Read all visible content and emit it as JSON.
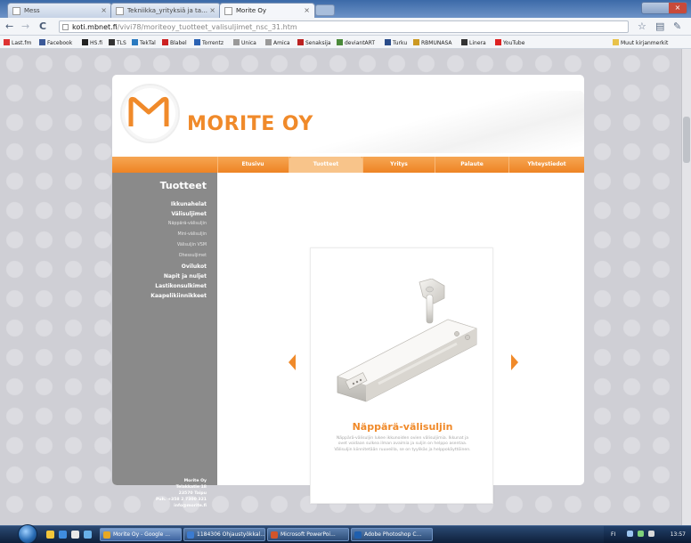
{
  "browser": {
    "tabs": [
      {
        "label": "Mess"
      },
      {
        "label": "Tekniikka_yrityksiä ja ta…"
      },
      {
        "label": "Morite Oy"
      }
    ],
    "address": {
      "host": "koti.mbnet.fi",
      "path": "/vivi78/moriteoy_tuotteet_valisuljimet_nsc_31.htm"
    },
    "nav_glyphs": {
      "back": "←",
      "forward": "→",
      "reload": "C"
    },
    "bookmarks": [
      {
        "label": "Last.fm",
        "color": "#d33"
      },
      {
        "label": "Facebook",
        "color": "#3b5998"
      },
      {
        "label": "HS.fi",
        "color": "#222"
      },
      {
        "label": "TLS",
        "color": "#333"
      },
      {
        "label": "TekTal",
        "color": "#2a7ac0"
      },
      {
        "label": "Blabel",
        "color": "#c22"
      },
      {
        "label": "Torrentz",
        "color": "#2b62b3"
      },
      {
        "label": "Unica",
        "color": "#999"
      },
      {
        "label": "Amica",
        "color": "#999"
      },
      {
        "label": "Senaksija",
        "color": "#b22"
      },
      {
        "label": "deviantART",
        "color": "#4a8a3a"
      },
      {
        "label": "Turku",
        "color": "#2a4c8a"
      },
      {
        "label": "RBMUNASA",
        "color": "#c92"
      },
      {
        "label": "Linera",
        "color": "#333"
      },
      {
        "label": "YouTube",
        "color": "#d22"
      }
    ],
    "other_bookmarks": "Muut kirjanmerkit"
  },
  "site": {
    "brand": "MORITE OY",
    "colors": {
      "accent": "#f08a2a",
      "sidebar": "#8a8a8a"
    },
    "menu": [
      {
        "label": "Etusivu",
        "active": false
      },
      {
        "label": "Tuotteet",
        "active": true
      },
      {
        "label": "Yritys",
        "active": false
      },
      {
        "label": "Palaute",
        "active": false
      },
      {
        "label": "Yhteystiedot",
        "active": false
      }
    ],
    "sidebar": {
      "title": "Tuotteet",
      "items": [
        {
          "label": "Ikkunahelat",
          "sub": false
        },
        {
          "label": "Välisuljimet",
          "sub": false
        },
        {
          "label": "Näppärä-välisuljin",
          "sub": true
        },
        {
          "label": "Mini-välisuljin",
          "sub": true
        },
        {
          "label": "Välisuljin VSM",
          "sub": true
        },
        {
          "label": "Ohessuljimet",
          "sub": true
        },
        {
          "label": "Ovilukot",
          "sub": false
        },
        {
          "label": "Napit ja nuljet",
          "sub": false
        },
        {
          "label": "Lastikonsulkimet",
          "sub": false
        },
        {
          "label": "Kaapelikiinnikkeet",
          "sub": false
        }
      ],
      "contact": [
        "Morite Oy",
        "Telakkatie 18",
        "23570 Taipu",
        "Puh. +358 2 7300 321",
        "info@morite.fi"
      ]
    },
    "product": {
      "name": "Näppärä-välisuljin",
      "description": "Näppärä-välisuljin lukee ikkunoiden ovien välisuljimia. Ikkunat ja ovet voidaan sulkea ilman avaimia ja suljin on helppo asentaa. Välisuljin kiinnitetään ruuveilla, se on tyylikäs ja helppokäyttöinen."
    }
  },
  "taskbar": {
    "tasks": [
      {
        "label": "Morite Oy - Google ...",
        "active": true
      },
      {
        "label": "1184306 Ohjaustyökkal...",
        "active": false
      },
      {
        "label": "Microsoft PowerPoi...",
        "active": false
      },
      {
        "label": "Adobe Photoshop C...",
        "active": false
      }
    ],
    "language": "FI",
    "clock": "13:57"
  }
}
